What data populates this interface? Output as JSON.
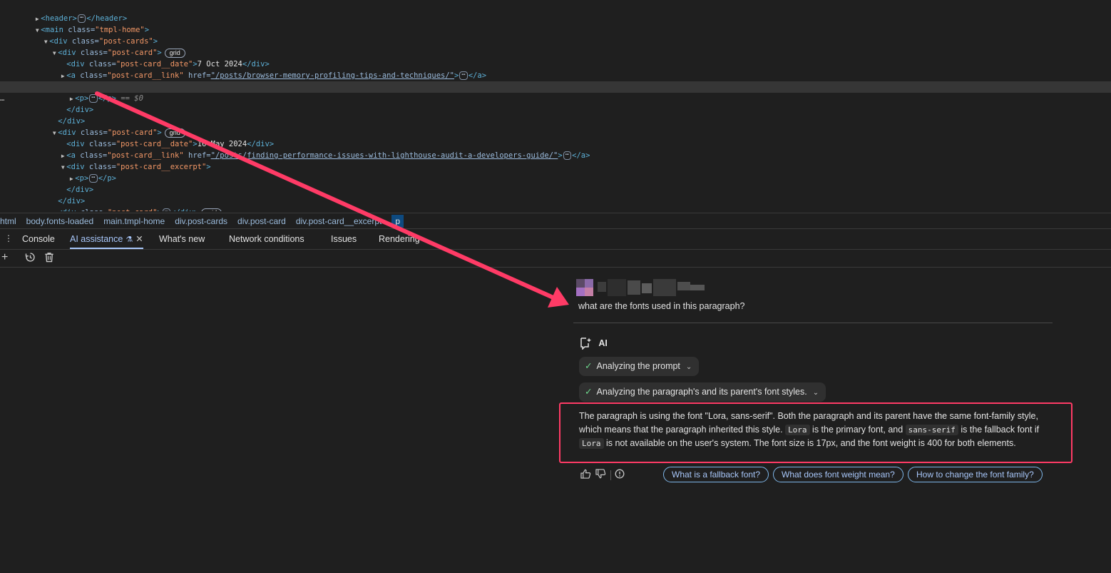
{
  "tree": {
    "header_open": "<header>",
    "header_close": "</header>",
    "main_open": "<main",
    "main_class_attr": "class=",
    "main_class_val": "\"tmpl-home\"",
    "gt": ">",
    "div_open": "<div",
    "div_close": "</div>",
    "a_open": "<a",
    "a_close": "</a>",
    "p_open": "<p>",
    "p_close": "</p>",
    "class_attr": "class=",
    "href_attr": "href=",
    "post_cards_val": "\"post-cards\"",
    "post_card_val": "\"post-card\"",
    "date_val": "\"post-card__date\"",
    "link_val": "\"post-card__link\"",
    "excerpt_val": "\"post-card__excerpt\"",
    "date1": "7 Oct 2024",
    "date2": "16 May 2024",
    "href1": "\"/posts/browser-memory-profiling-tips-and-techniques/\"",
    "href2": "\"/posts/finding-performance-issues-with-lighthouse-audit-a-developers-guide/\"",
    "grid_badge": "grid",
    "ellipsis": "⋯",
    "selected_marker": "== $0",
    "row_dots": "…"
  },
  "breadcrumbs": [
    "html",
    "body.fonts-loaded",
    "main.tmpl-home",
    "div.post-cards",
    "div.post-card",
    "div.post-card__excerpt",
    "p"
  ],
  "tabs": {
    "console": "Console",
    "ai": "AI assistance",
    "whats_new": "What's new",
    "network": "Network conditions",
    "issues": "Issues",
    "rendering": "Rendering"
  },
  "chat": {
    "question": "what are the fonts used in this paragraph?",
    "ai_label": "AI",
    "step1": "Analyzing the prompt",
    "step2": "Analyzing the paragraph's and its parent's font styles.",
    "answer": {
      "p1": "The paragraph is using the font \"Lora, sans-serif\". Both the paragraph and its parent have the same font-family style, which means that the paragraph inherited this style. ",
      "code1": "Lora",
      "p2": " is the primary font, and ",
      "code2": "sans-serif",
      "p3": " is the fallback font if ",
      "code3": "Lora",
      "p4": " is not available on the user's system. The font size is 17px, and the font weight is 400 for both elements."
    },
    "suggestions": [
      "What is a fallback font?",
      "What does font weight mean?",
      "How to change the font family?"
    ]
  },
  "colors": {
    "background": "#1f1f1f",
    "accent": "#a8c7fa",
    "annotation": "#ff3b66",
    "success": "#6dd58c"
  },
  "icons": [
    "tree-toggle-icon",
    "kebab-menu-icon",
    "experiment-flask-icon",
    "close-icon",
    "new-chat-icon",
    "history-icon",
    "delete-icon",
    "ai-sparkle-icon",
    "checkmark-icon",
    "chevron-down-icon",
    "thumbs-up-icon",
    "thumbs-down-icon",
    "report-icon",
    "annotation-arrow"
  ]
}
